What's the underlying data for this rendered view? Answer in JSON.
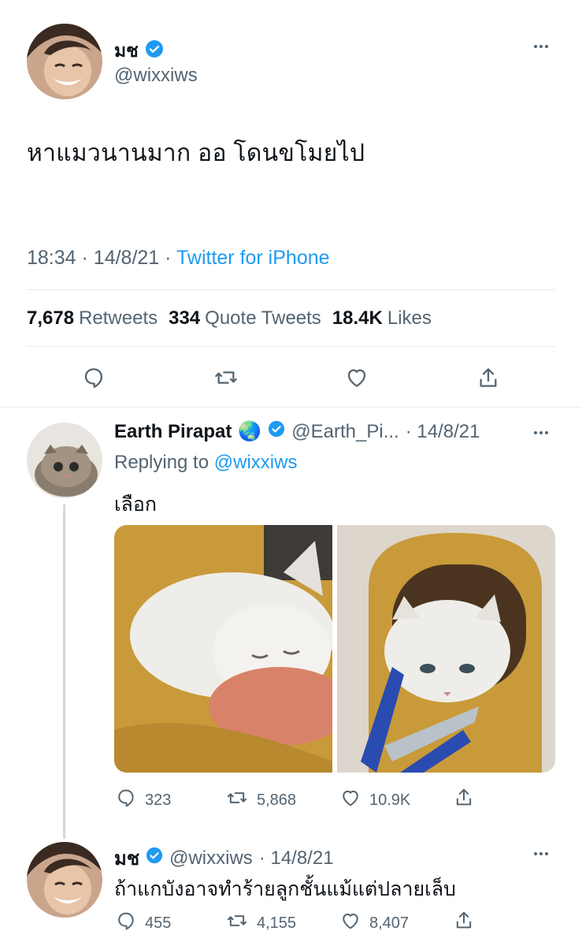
{
  "main_tweet": {
    "display_name": "มช",
    "handle": "@wixxiws",
    "text": "หาแมวนานมาก ออ โดนขโมยไป",
    "time": "18:34",
    "date": "14/8/21",
    "source": "Twitter for iPhone",
    "retweets_count": "7,678",
    "retweets_label": "Retweets",
    "quotes_count": "334",
    "quotes_label": "Quote Tweets",
    "likes_count": "18.4K",
    "likes_label": "Likes"
  },
  "reply1": {
    "display_name": "Earth Pirapat",
    "name_emoji": "🌏",
    "handle": "@Earth_Pi...",
    "date": "· 14/8/21",
    "replying_prefix": "Replying to",
    "replying_handle": "@wixxiws",
    "text": "เลือก",
    "replies": "323",
    "retweets": "5,868",
    "likes": "10.9K"
  },
  "reply2": {
    "display_name": "มช",
    "handle": "@wixxiws",
    "date": "· 14/8/21",
    "text": "ถ้าแกบังอาจทำร้ายลูกชั้นแม้แต่ปลายเล็บ",
    "replies": "455",
    "retweets": "4,155",
    "likes": "8,407"
  },
  "colors": {
    "accent": "#1d9bf0",
    "muted": "#536471",
    "divider": "#e6ecf0",
    "text": "#0f1419"
  }
}
